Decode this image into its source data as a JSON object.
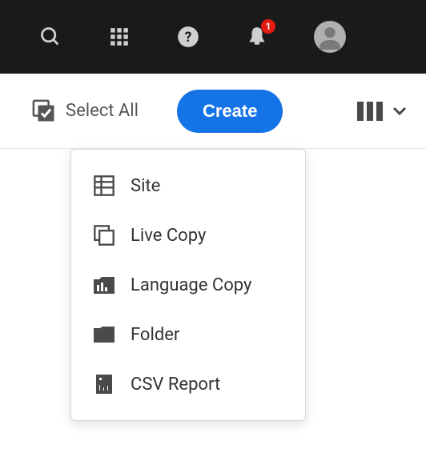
{
  "topbar": {
    "notification_count": "1"
  },
  "actionbar": {
    "select_all_label": "Select All",
    "create_label": "Create"
  },
  "create_menu": {
    "items": [
      {
        "label": "Site"
      },
      {
        "label": "Live Copy"
      },
      {
        "label": "Language Copy"
      },
      {
        "label": "Folder"
      },
      {
        "label": "CSV Report"
      }
    ]
  }
}
